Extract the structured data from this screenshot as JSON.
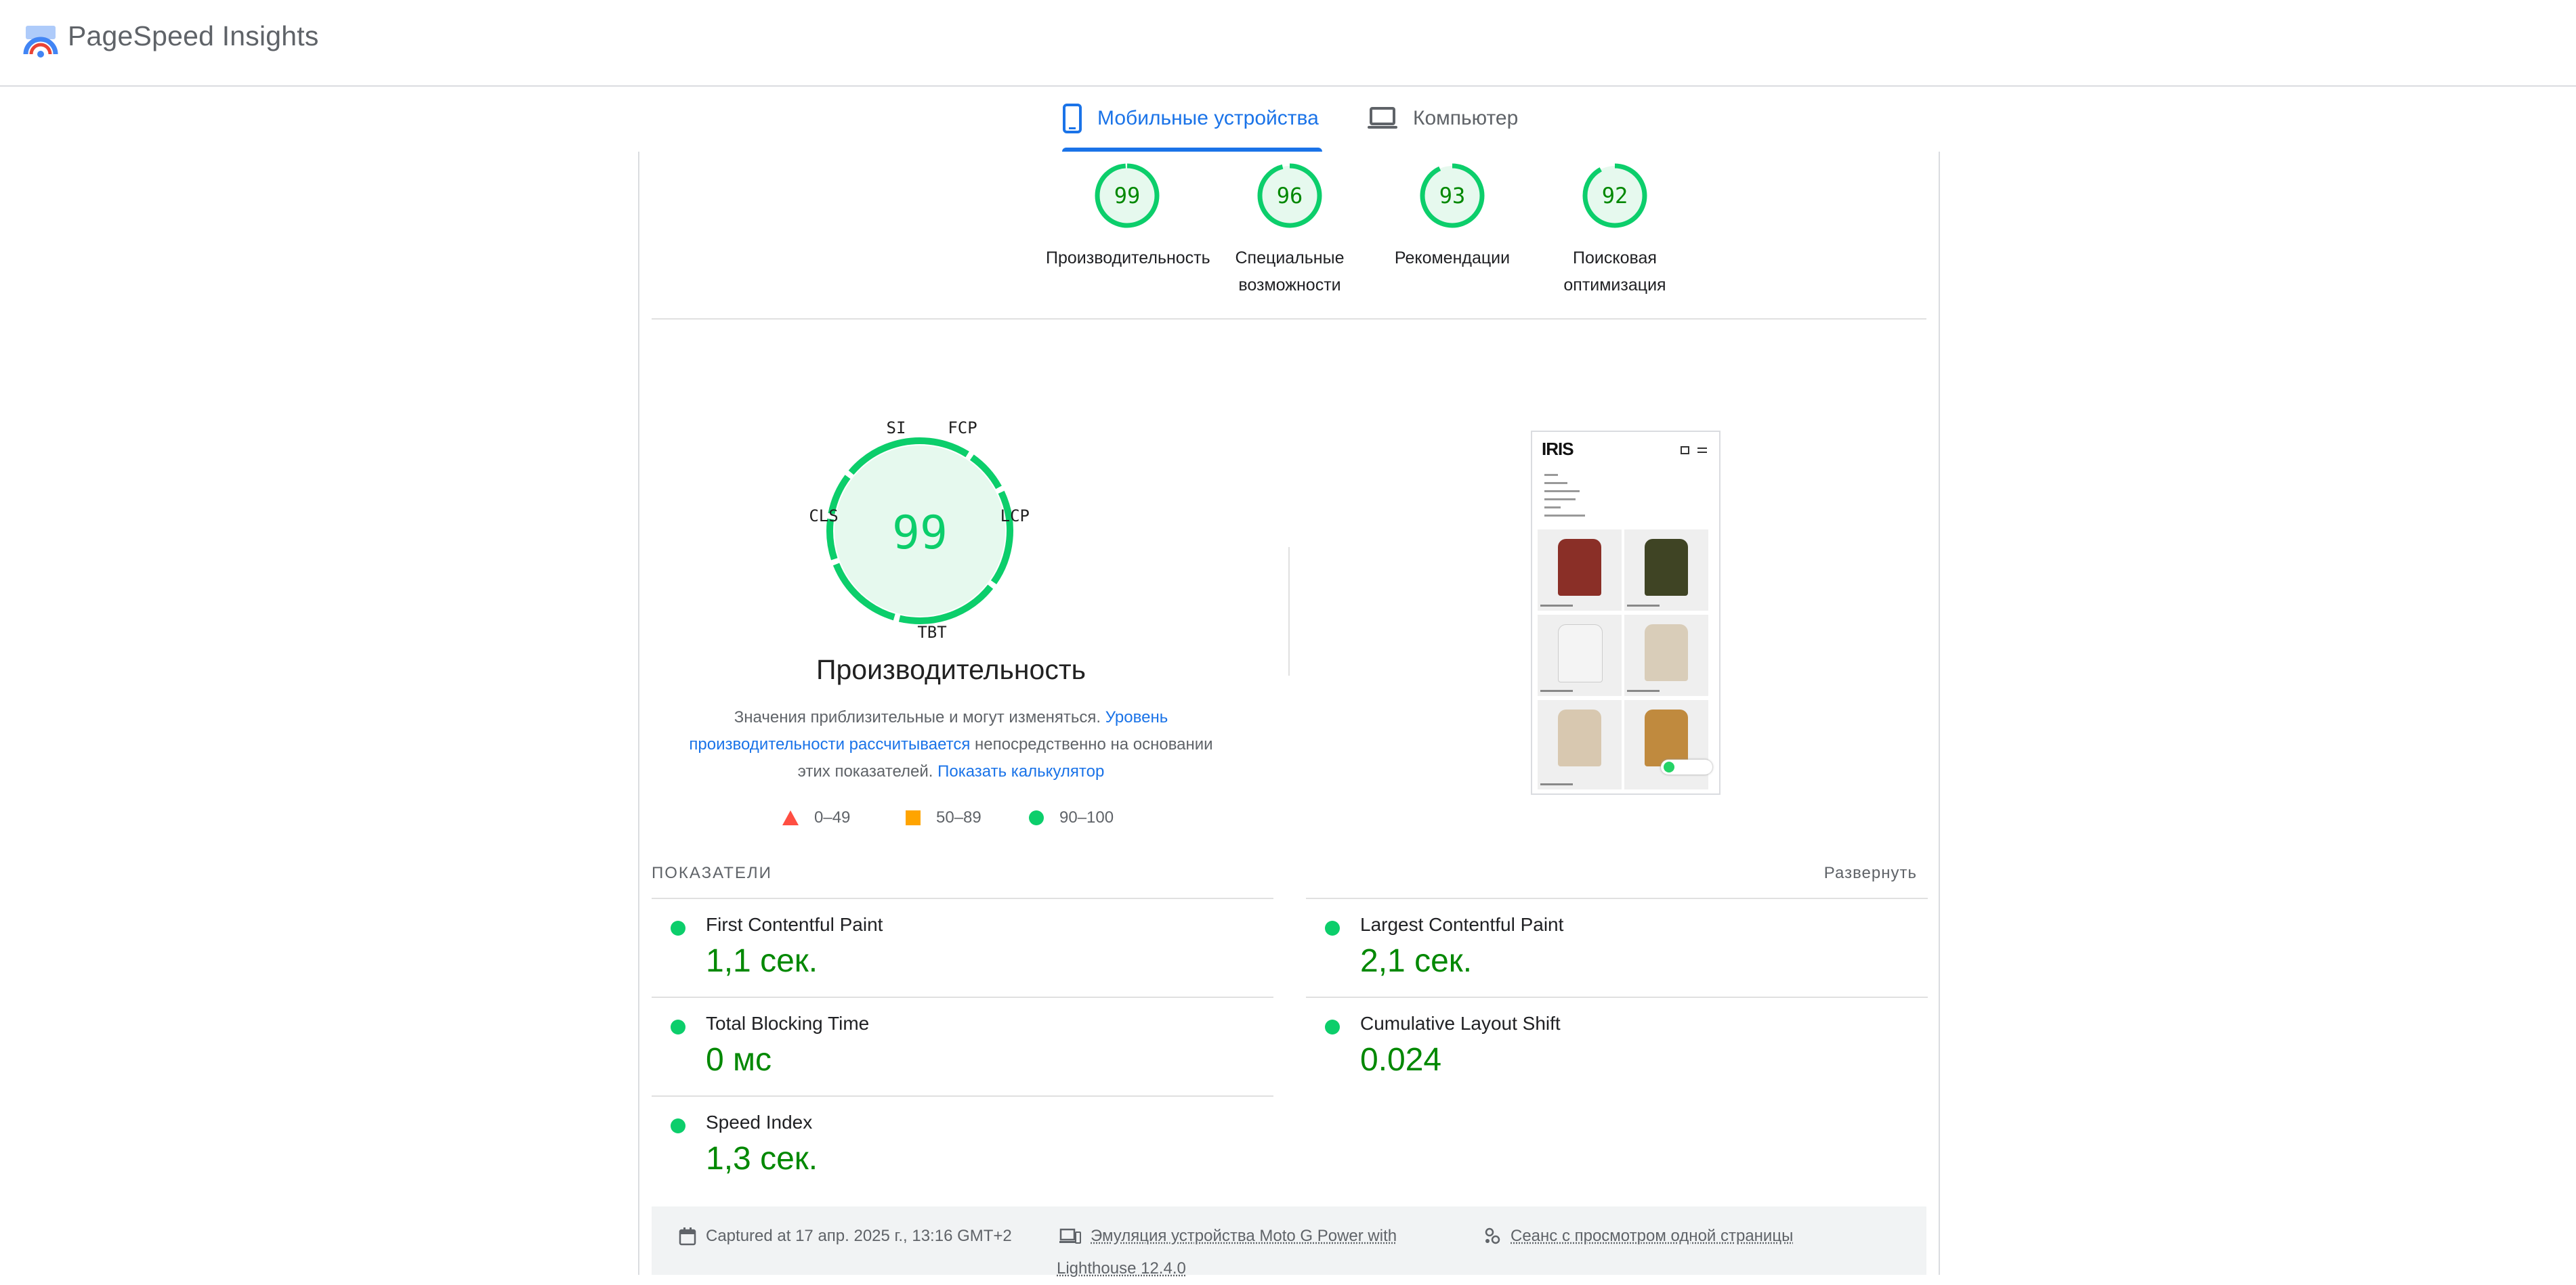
{
  "app": {
    "title": "PageSpeed Insights"
  },
  "tabs": [
    {
      "label": "Мобильные устройства",
      "active": true
    },
    {
      "label": "Компьютер",
      "active": false
    }
  ],
  "categories": [
    {
      "score": "99",
      "label": "Производительность"
    },
    {
      "score": "96",
      "label": "Специальные возможности"
    },
    {
      "score": "93",
      "label": "Рекомендации"
    },
    {
      "score": "92",
      "label": "Поисковая оптимизация"
    }
  ],
  "performance": {
    "score": "99",
    "title": "Производительность",
    "desc_text1": "Значения приблизительные и могут изменяться.",
    "desc_link1": "Уровень производительности рассчитывается",
    "desc_text2": "непосредственно на основании этих показателей.",
    "desc_link2": "Показать калькулятор",
    "gauge_labels": {
      "si": "SI",
      "fcp": "FCP",
      "lcp": "LCP",
      "tbt": "TBT",
      "cls": "CLS"
    }
  },
  "legend": [
    {
      "range": "0–49",
      "shape": "triangle",
      "color": "#ff4e42"
    },
    {
      "range": "50–89",
      "shape": "square",
      "color": "#ffa400"
    },
    {
      "range": "90–100",
      "shape": "circle",
      "color": "#0cce6b"
    }
  ],
  "screenshot": {
    "logo_text": "IRIS"
  },
  "metrics": {
    "header": "ПОКАЗАТЕЛИ",
    "expand_label": "Развернуть",
    "items": [
      {
        "name": "First Contentful Paint",
        "value": "1,1 сек."
      },
      {
        "name": "Largest Contentful Paint",
        "value": "2,1 сек."
      },
      {
        "name": "Total Blocking Time",
        "value": "0 мс"
      },
      {
        "name": "Cumulative Layout Shift",
        "value": "0.024"
      },
      {
        "name": "Speed Index",
        "value": "1,3 сек."
      }
    ]
  },
  "footer": {
    "captured": "Captured at 17 апр. 2025 г., 13:16 GMT+2",
    "emulation_line1": "Эмуляция устройства Moto G Power with",
    "emulation_line2": "Lighthouse 12.4.0",
    "session": "Сеанс с просмотром одной страницы"
  },
  "colors": {
    "pass": "#0cce6b",
    "pass_text": "#008800",
    "pass_bg": "#e6f9ee",
    "accent": "#1a73e8"
  }
}
